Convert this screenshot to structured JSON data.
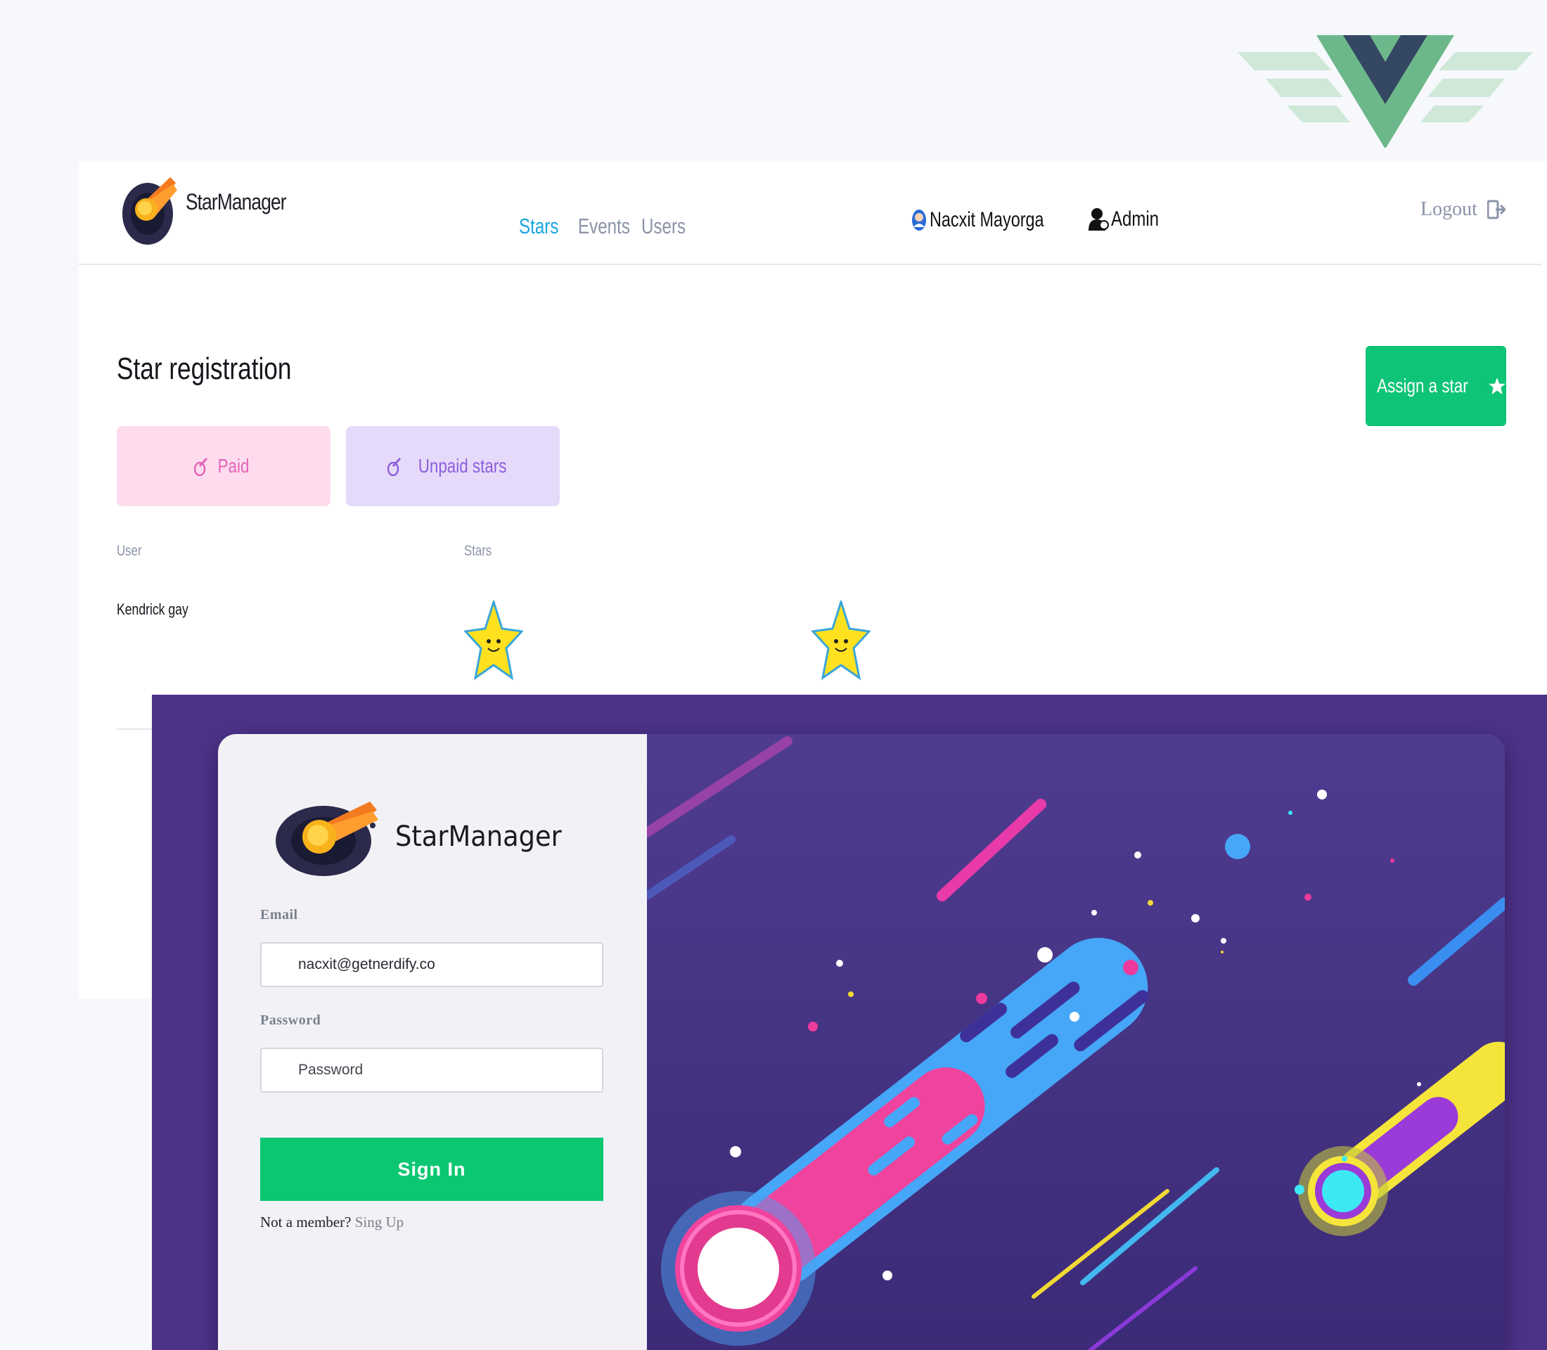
{
  "brand": {
    "name": "StarManager"
  },
  "nav": {
    "items": [
      {
        "label": "Stars",
        "active": true
      },
      {
        "label": "Events",
        "active": false
      },
      {
        "label": "Users",
        "active": false
      }
    ]
  },
  "header": {
    "user_name": "Nacxit Mayorga",
    "role": "Admin",
    "logout_label": "Logout"
  },
  "page": {
    "title": "Star registration",
    "assign_button": "Assign a star",
    "tabs": [
      {
        "label": "Paid"
      },
      {
        "label": "Unpaid stars"
      }
    ],
    "table": {
      "columns": [
        "User",
        "Stars"
      ],
      "rows": [
        {
          "user": "Kendrick gay",
          "stars": 2
        }
      ]
    }
  },
  "login": {
    "brand_name": "StarManager",
    "email_label": "Email",
    "email_value": "nacxit@getnerdify.co",
    "password_label": "Password",
    "password_placeholder": "Password",
    "signin_label": "Sign In",
    "member_text": "Not a member?",
    "signup_link": "Sing Up"
  },
  "colors": {
    "accent_green": "#0ec476",
    "nav_active": "#1ba4e0",
    "paid_bg": "#fedcee",
    "unpaid_bg": "#e6dafb",
    "login_bg": "#4d3289"
  },
  "icons": [
    "vue-logo",
    "starmanager-logo-icon",
    "user-avatar-icon",
    "admin-user-icon",
    "logout-icon",
    "star-icon",
    "meteor-icon",
    "smiling-star-icon"
  ]
}
